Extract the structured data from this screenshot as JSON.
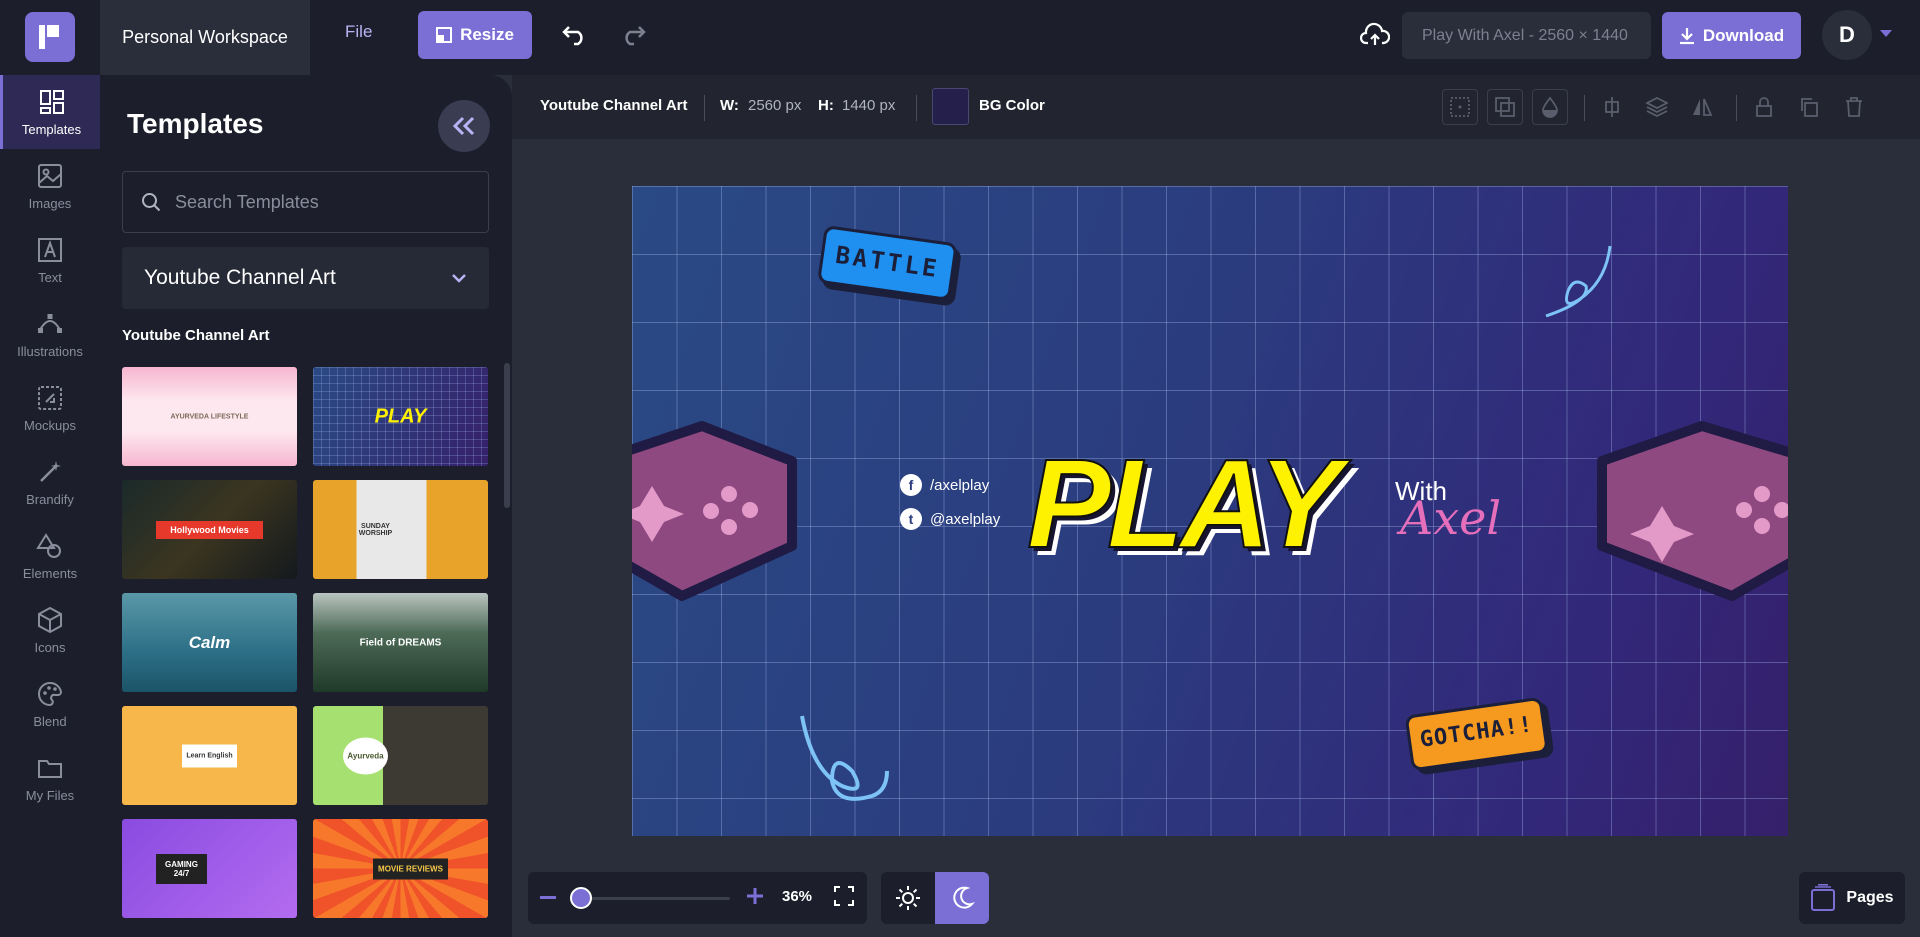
{
  "topbar": {
    "workspace": "Personal Workspace",
    "file_label": "File",
    "resize_label": "Resize",
    "doc_name": "Play With Axel - 2560 × 1440",
    "download_label": "Download",
    "avatar_initial": "D"
  },
  "rail": {
    "items": [
      {
        "label": "Templates",
        "icon": "templates-icon"
      },
      {
        "label": "Images",
        "icon": "image-icon"
      },
      {
        "label": "Text",
        "icon": "text-icon"
      },
      {
        "label": "Illustrations",
        "icon": "illustrations-icon"
      },
      {
        "label": "Mockups",
        "icon": "mockups-icon"
      },
      {
        "label": "Brandify",
        "icon": "brandify-icon"
      },
      {
        "label": "Elements",
        "icon": "elements-icon"
      },
      {
        "label": "Icons",
        "icon": "icons-icon"
      },
      {
        "label": "Blend",
        "icon": "blend-icon"
      },
      {
        "label": "My Files",
        "icon": "folder-icon"
      }
    ]
  },
  "panel": {
    "title": "Templates",
    "search_placeholder": "Search Templates",
    "category": "Youtube Channel Art",
    "section_label": "Youtube Channel Art",
    "thumbnails": [
      {
        "label": "AYURVEDA LIFESTYLE"
      },
      {
        "label": "PLAY"
      },
      {
        "label": "Hollywood Movies"
      },
      {
        "label": "SUNDAY WORSHIP"
      },
      {
        "label": "Calm"
      },
      {
        "label": "Field of DREAMS"
      },
      {
        "label": "Learn English"
      },
      {
        "label": "Ayurveda"
      },
      {
        "label": "GAMING 24/7"
      },
      {
        "label": "MOVIE REVIEWS"
      }
    ]
  },
  "canvas_toolbar": {
    "doc_type": "Youtube Channel Art",
    "w_label": "W:",
    "w_value": "2560 px",
    "h_label": "H:",
    "h_value": "1440 px",
    "bg_label": "BG Color",
    "bg_color": "#24204b"
  },
  "design": {
    "battle": "BATTLE",
    "gotcha": "GOTCHA!!",
    "play": "PLAY",
    "with": "With",
    "axel": "Axel",
    "facebook": "/axelplay",
    "twitter": "@axelplay"
  },
  "bottom": {
    "zoom": "36%",
    "zoom_fraction": 0.36,
    "pages_label": "Pages"
  },
  "colors": {
    "accent": "#7b6fd6",
    "panel_bg": "#1c1f2b",
    "workspace_bg": "#2a2d3a"
  }
}
